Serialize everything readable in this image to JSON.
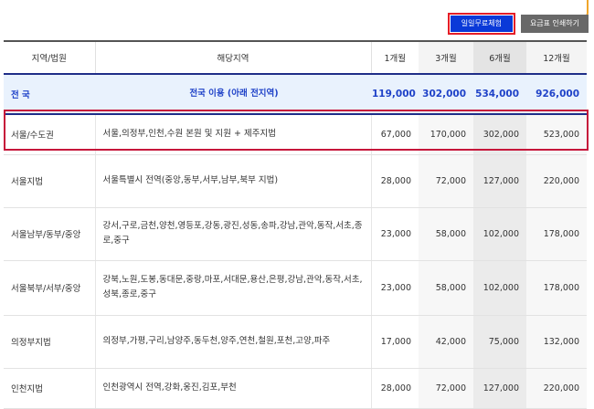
{
  "buttons": {
    "free_trial": "일일무료체험",
    "print_fee": "요금표 인쇄하기"
  },
  "columns": {
    "region": "지역/법원",
    "area": "해당지역",
    "m1": "1개월",
    "m3": "3개월",
    "m6": "6개월",
    "m12": "12개월"
  },
  "national": {
    "region": "전 국",
    "area": "전국 이용 (아래 전지역)",
    "m1": "119,000",
    "m3": "302,000",
    "m6": "534,000",
    "m12": "926,000"
  },
  "rows": [
    {
      "region": "서울/수도권",
      "area": "서울,의정부,인천,수원 본원 및 지원 + 제주지법",
      "m1": "67,000",
      "m3": "170,000",
      "m6": "302,000",
      "m12": "523,000"
    },
    {
      "region": "서울지법",
      "area": "서울특별시 전역(중앙,동부,서부,남부,북부 지법)",
      "m1": "28,000",
      "m3": "72,000",
      "m6": "127,000",
      "m12": "220,000"
    },
    {
      "region": "서울남부/동부/중앙",
      "area": "강서,구로,금천,양천,영등포,강동,광진,성동,송파,강남,관악,동작,서초,종로,중구",
      "m1": "23,000",
      "m3": "58,000",
      "m6": "102,000",
      "m12": "178,000"
    },
    {
      "region": "서울북부/서부/중앙",
      "area": "강북,노원,도봉,동대문,중랑,마포,서대문,용산,은평,강남,관악,동작,서초,성북,종로,중구",
      "m1": "23,000",
      "m3": "58,000",
      "m6": "102,000",
      "m12": "178,000"
    },
    {
      "region": "의정부지법",
      "area": "의정부,가평,구리,남양주,동두천,양주,연천,철원,포천,고양,파주",
      "m1": "17,000",
      "m3": "42,000",
      "m6": "75,000",
      "m12": "132,000"
    },
    {
      "region": "인천지법",
      "area": "인천광역시 전역,강화,옹진,김포,부천",
      "m1": "28,000",
      "m3": "72,000",
      "m6": "127,000",
      "m12": "220,000"
    }
  ]
}
